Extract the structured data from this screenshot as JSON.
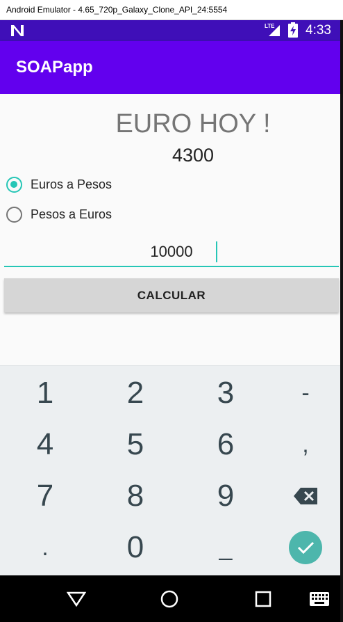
{
  "window": {
    "title": "Android Emulator - 4.65_720p_Galaxy_Clone_API_24:5554"
  },
  "status_bar": {
    "network_label": "LTE",
    "time": "4:33"
  },
  "app_bar": {
    "title": "SOAPapp"
  },
  "main": {
    "heading": "EURO HOY !",
    "rate": "4300",
    "radio_options": [
      {
        "label": "Euros a Pesos",
        "selected": true
      },
      {
        "label": "Pesos a Euros",
        "selected": false
      }
    ],
    "amount_value": "10000",
    "calculate_label": "CALCULAR"
  },
  "keypad": {
    "keys": [
      "1",
      "2",
      "3",
      "-",
      "4",
      "5",
      "6",
      ",",
      "7",
      "8",
      "9",
      ".",
      "0",
      "_"
    ],
    "icons": {
      "backspace": "backspace-icon",
      "done": "check-icon"
    }
  },
  "nav_bar": {
    "icons": [
      "back-triangle-icon",
      "home-circle-icon",
      "recents-square-icon",
      "keyboard-icon"
    ]
  },
  "colors": {
    "accent": "#26c6b6",
    "primary": "#6200ee",
    "primary_dark": "#3f0fb8"
  }
}
